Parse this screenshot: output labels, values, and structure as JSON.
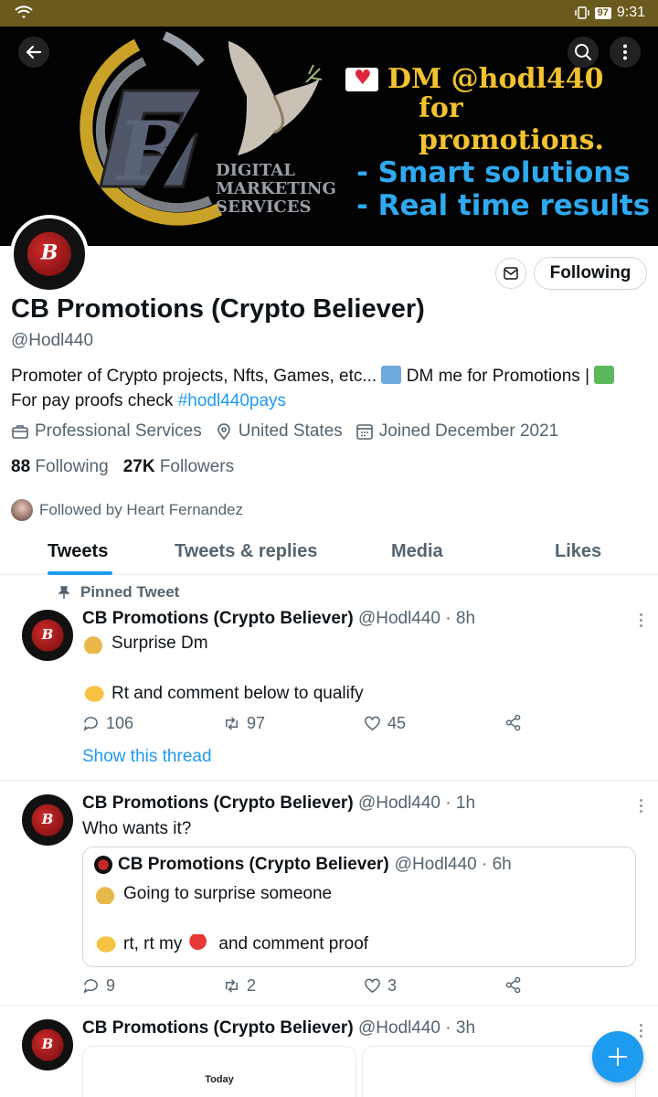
{
  "status_bar": {
    "battery": "97",
    "time": "9:31"
  },
  "banner": {
    "dm_text": "DM @hodl440",
    "promo_text": "for promotions.",
    "service_lines": [
      "DIGITAL",
      "MARKETING",
      "SERVICES"
    ],
    "slogan_lines": [
      "- Smart solutions",
      "- Real time results"
    ],
    "logo_letter": "B"
  },
  "profile": {
    "avatar_letter": "B",
    "following_button": "Following",
    "name": "CB Promotions (Crypto Believer)",
    "handle": "@Hodl440",
    "bio_part1": "Promoter of Crypto projects, Nfts, Games, etc... ",
    "bio_part2": " DM me for Promotions | ",
    "bio_part3": " For pay proofs check ",
    "bio_hashtag": "#hodl440pays",
    "category": "Professional Services",
    "location": "United States",
    "joined": "Joined December 2021",
    "following_count": "88",
    "following_label": "Following",
    "followers_count": "27K",
    "followers_label": "Followers",
    "followed_by": "Followed by Heart Fernandez"
  },
  "tabs": [
    "Tweets",
    "Tweets & replies",
    "Media",
    "Likes"
  ],
  "tweets": [
    {
      "pinned_label": "Pinned Tweet",
      "name": "CB Promotions (Crypto Believer)",
      "handle_time": "@Hodl440 · 8h",
      "line1": "Surprise Dm",
      "line2": "Rt and comment below to qualify",
      "replies": "106",
      "retweets": "97",
      "likes": "45",
      "show_thread": "Show this thread"
    },
    {
      "name": "CB Promotions (Crypto Believer)",
      "handle_time": "@Hodl440 · 1h",
      "text": "Who wants it?",
      "quote": {
        "name": "CB Promotions (Crypto Believer)",
        "handle_time": "@Hodl440 · 6h",
        "line1": "Going to surprise someone",
        "line2a": "rt, rt my",
        "line2b": "and comment proof"
      },
      "replies": "9",
      "retweets": "2",
      "likes": "3"
    },
    {
      "name": "CB Promotions (Crypto Believer)",
      "handle_time": "@Hodl440 · 3h",
      "image_caption": "Today"
    }
  ],
  "icons": {
    "accent": "#1d9bf0",
    "status_bar_bg": "#6b5a1e",
    "banner_gold": "#f2c230",
    "banner_blue": "#2fa9f0"
  }
}
